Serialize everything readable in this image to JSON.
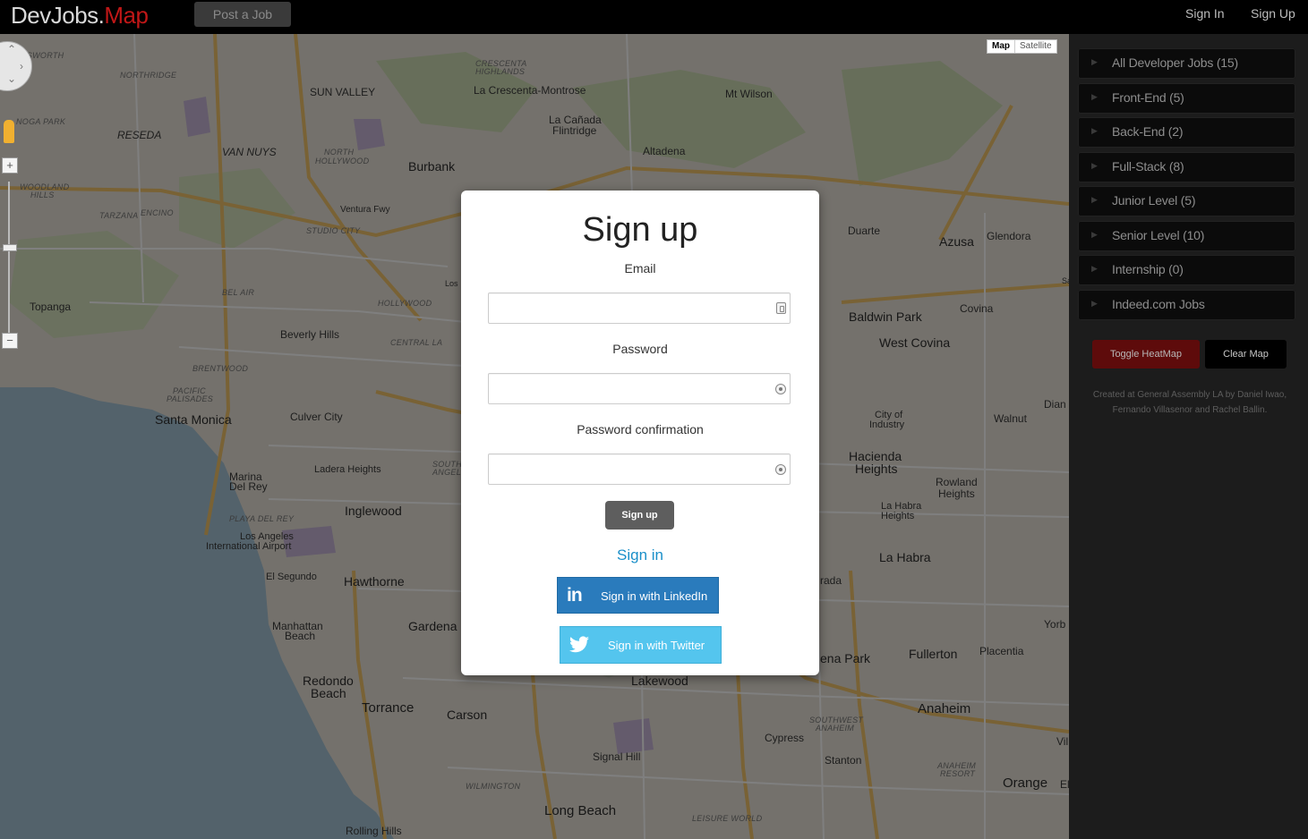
{
  "navbar": {
    "brand_main": "DevJobs.",
    "brand_accent": "Map",
    "post_job": "Post a Job",
    "sign_in": "Sign In",
    "sign_up": "Sign Up"
  },
  "map": {
    "map_type_options": [
      "Map",
      "Satellite"
    ],
    "active_map_type": "Map",
    "labels": [
      "Burbank",
      "La Crescenta-Montrose",
      "Mt Wilson",
      "Altadena",
      "La Cañada",
      "Flintridge",
      "SUN VALLEY",
      "NORTHRIDGE",
      "RESEDA",
      "VAN NUYS",
      "NORTH",
      "HOLLYWOOD",
      "TARZANA",
      "ENCINO",
      "WOODLAND",
      "HILLS",
      "STUDIO CITY",
      "Ventura Fwy",
      "HOLLYWOOD",
      "Topanga",
      "BEL AIR",
      "Beverly Hills",
      "CENTRAL LA",
      "BRENTWOOD",
      "PACIFIC",
      "PALISADES",
      "Santa Monica",
      "Culver City",
      "Marina",
      "Del Rey",
      "Ladera Heights",
      "Inglewood",
      "PLAYA DEL REY",
      "Los Angeles",
      "International Airport",
      "El Segundo",
      "Hawthorne",
      "Manhattan",
      "Beach",
      "Gardena",
      "Redondo",
      "Beach",
      "Torrance",
      "Carson",
      "Lakewood",
      "Signal Hill",
      "Long Beach",
      "WILMINGTON",
      "Rolling Hills",
      "Cypress",
      "Stanton",
      "SOUTHWEST",
      "ANAHEIM",
      "Anaheim",
      "ANAHEIM",
      "RESORT",
      "Orange",
      "Fullerton",
      "Placentia",
      "La Habra",
      "La Habra",
      "Heights",
      "Rowland",
      "Heights",
      "Hacienda",
      "Heights",
      "City of",
      "Industry",
      "Walnut",
      "West Covina",
      "Baldwin Park",
      "Covina",
      "Duarte",
      "Azusa",
      "Glendora",
      "CRESCENTA",
      "HIGHLANDS",
      "LEISURE WORLD",
      "ena Park",
      "rada",
      "Yorb",
      "Dian",
      "SOUTH",
      "ANGELES",
      "NOGA PARK",
      "TSWORTH",
      "Vil",
      "El",
      "Los",
      "Sa"
    ]
  },
  "signup_modal": {
    "title": "Sign up",
    "email_label": "Email",
    "email_value": "",
    "password_label": "Password",
    "password_value": "",
    "password_confirmation_label": "Password confirmation",
    "password_confirmation_value": "",
    "submit_label": "Sign up",
    "signin_link": "Sign in",
    "linkedin_label": "Sign in with LinkedIn",
    "linkedin_glyph": "in",
    "twitter_label": "Sign in with Twitter"
  },
  "sidebar": {
    "categories": [
      "All Developer Jobs (15)",
      "Front-End (5)",
      "Back-End (2)",
      "Full-Stack (8)",
      "Junior Level (5)",
      "Senior Level (10)",
      "Internship (0)",
      "Indeed.com Jobs"
    ],
    "toggle_heatmap": "Toggle HeatMap",
    "clear_map": "Clear Map",
    "credits": "Created at General Assembly LA by Daniel Iwao, Fernando Villasenor and Rachel Ballin."
  },
  "colors": {
    "brand_accent": "#c01717",
    "linkedin": "#2a7bbc",
    "twitter": "#54c5ee",
    "link": "#1a8fc9",
    "heatmap_button": "#5e0b0b"
  }
}
